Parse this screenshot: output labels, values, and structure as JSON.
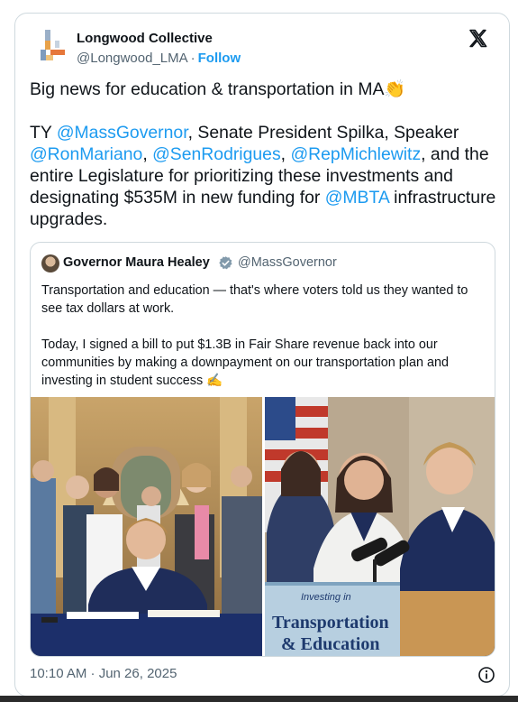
{
  "author": {
    "name": "Longwood Collective",
    "handle": "@Longwood_LMA",
    "separator": "·",
    "follow_label": "Follow"
  },
  "platform_icon": "x-logo-icon",
  "tweet": {
    "line1": "Big news for education & transportation in MA",
    "line1_emoji": "👏",
    "p2_a": "TY ",
    "mention_governor": "@MassGovernor",
    "p2_b": ", Senate President Spilka, Speaker ",
    "mention_mariano": "@RonMariano",
    "p2_c": ", ",
    "mention_rodrigues": "@SenRodrigues",
    "p2_d": ", ",
    "mention_michlewitz": "@RepMichlewitz",
    "p2_e": ", and the entire Legislature for prioritizing these investments and designating $535M in new funding for ",
    "mention_mbta": "@MBTA",
    "p2_f": " infrastructure upgrades."
  },
  "quote": {
    "name": "Governor Maura Healey",
    "verified_icon": "verified-badge-icon",
    "handle": "@MassGovernor",
    "para1": "Transportation and education — that's where voters told us they wanted to see tax dollars at work.",
    "para2": "Today, I signed a bill to put $1.3B in Fair Share revenue back into our communities by making a downpayment on our transportation plan and investing in student success ✍️",
    "photo2_sign_small": "Investing in",
    "photo2_sign_big1": "Transportation",
    "photo2_sign_big2": "& Education"
  },
  "meta": {
    "timestamp": "10:10 AM · Jun 26, 2025",
    "info_icon": "info-icon"
  },
  "colors": {
    "link": "#1d9bf0",
    "secondary_text": "#536471",
    "border": "#cfd9de"
  }
}
